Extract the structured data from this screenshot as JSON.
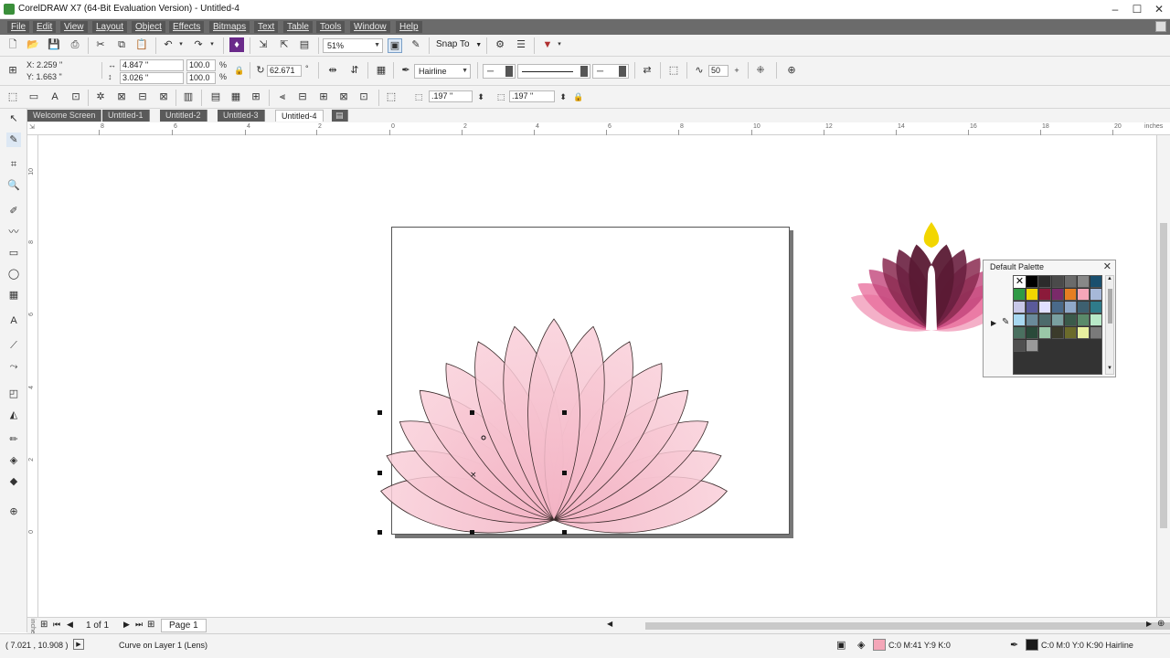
{
  "window": {
    "title": "CorelDRAW X7 (64-Bit Evaluation Version) - Untitled-4",
    "min": "–",
    "max": "☐",
    "close": "✕"
  },
  "menu": [
    "File",
    "Edit",
    "View",
    "Layout",
    "Object",
    "Effects",
    "Bitmaps",
    "Text",
    "Table",
    "Tools",
    "Window",
    "Help"
  ],
  "standard_toolbar": {
    "zoom_level": "51%",
    "snap_to": "Snap To"
  },
  "property_bar": {
    "x": "X: 2.259 \"",
    "y": "Y: 1.663 \"",
    "width": "4.847 \"",
    "height": "3.026 \"",
    "scale_w": "100.0",
    "scale_h": "100.0",
    "percent": "%",
    "rotation": "62.671",
    "degree": "°",
    "outline_width": "Hairline",
    "miter": "50"
  },
  "third_toolbar": {
    "nudge_h": ".197 \"",
    "nudge_v": ".197 \""
  },
  "doc_tabs": [
    "Welcome Screen",
    "Untitled-1",
    "Untitled-2",
    "Untitled-3",
    "Untitled-4"
  ],
  "active_tab_index": 4,
  "ruler": {
    "h_labels": [
      "8",
      "6",
      "4",
      "2",
      "0",
      "2",
      "4",
      "6",
      "8",
      "10",
      "12",
      "14",
      "16",
      "18",
      "20"
    ],
    "h_unit": "inches",
    "v_labels": [
      "10",
      "8",
      "6",
      "4",
      "2",
      "0"
    ],
    "v_unit": "inches"
  },
  "page_nav": {
    "count": "1 of 1",
    "page_tab": "Page 1"
  },
  "status": {
    "coords": "( 7.021 , 10.908 )",
    "object_info": "Curve on Layer 1  (Lens)",
    "fill_info": "C:0 M:41 Y:9 K:0",
    "outline_info": "C:0 M:0 Y:0 K:90  Hairline"
  },
  "palette": {
    "title": "Default Palette",
    "colors": [
      "#000000",
      "#2b2b2b",
      "#4a4a4a",
      "#6b6b6b",
      "#888888",
      "#1a4f6e",
      "#2f9a45",
      "#f2d600",
      "#8b1a3a",
      "#7a2a6a",
      "#e67e22",
      "#f4a6b8",
      "#a6b8d8",
      "#c8c8e8",
      "#5a5a9a",
      "#e0e0ff",
      "#4a6a8a",
      "#8fa8c8",
      "#3d6070",
      "#2f7b8a",
      "#a8d8f0",
      "#6a8a9a",
      "#4d6b6b",
      "#7aa0a0",
      "#3a5a4a",
      "#5a8a6a",
      "#b8e8c8",
      "#4a7060",
      "#2a4a3a",
      "#9ac8a8",
      "#3b3b2b",
      "#6b6b2b",
      "#e8f0a0",
      "#7a7a7a",
      "#505050",
      "#9a9a9a"
    ]
  },
  "colors": {
    "menubar_bg": "#6b6b6b",
    "petal_pink": "#f7c3d0",
    "petal_stroke": "#3a2a2a",
    "lotus_magenta": "#8a1848"
  }
}
